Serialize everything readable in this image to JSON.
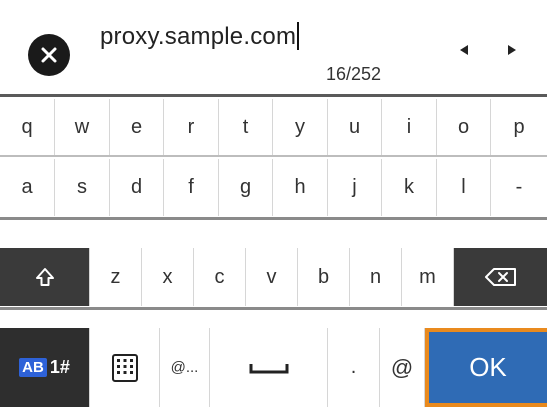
{
  "input": {
    "value": "proxy.sample.com",
    "counter": "16/252"
  },
  "icons": {
    "clear": "close-icon",
    "left": "arrow-left-icon",
    "right": "arrow-right-icon",
    "shift": "shift-icon",
    "backspace": "backspace-icon",
    "keypad": "keypad-grid-icon",
    "space": "space-icon"
  },
  "keyboard": {
    "row1": [
      "q",
      "w",
      "e",
      "r",
      "t",
      "y",
      "u",
      "i",
      "o",
      "p"
    ],
    "row2": [
      "a",
      "s",
      "d",
      "f",
      "g",
      "h",
      "j",
      "k",
      "l",
      "-"
    ],
    "row3": [
      "z",
      "x",
      "c",
      "v",
      "b",
      "n",
      "m"
    ],
    "mode": {
      "badge": "AB",
      "label": "1#"
    },
    "email_key": "@...",
    "period_key": ".",
    "at_key": "@",
    "ok_label": "OK"
  },
  "colors": {
    "ok": "#2f6bb5",
    "ok_border": "#e98a1e",
    "dark_key": "#2e2e2e",
    "mode_badge": "#2e62d8"
  }
}
